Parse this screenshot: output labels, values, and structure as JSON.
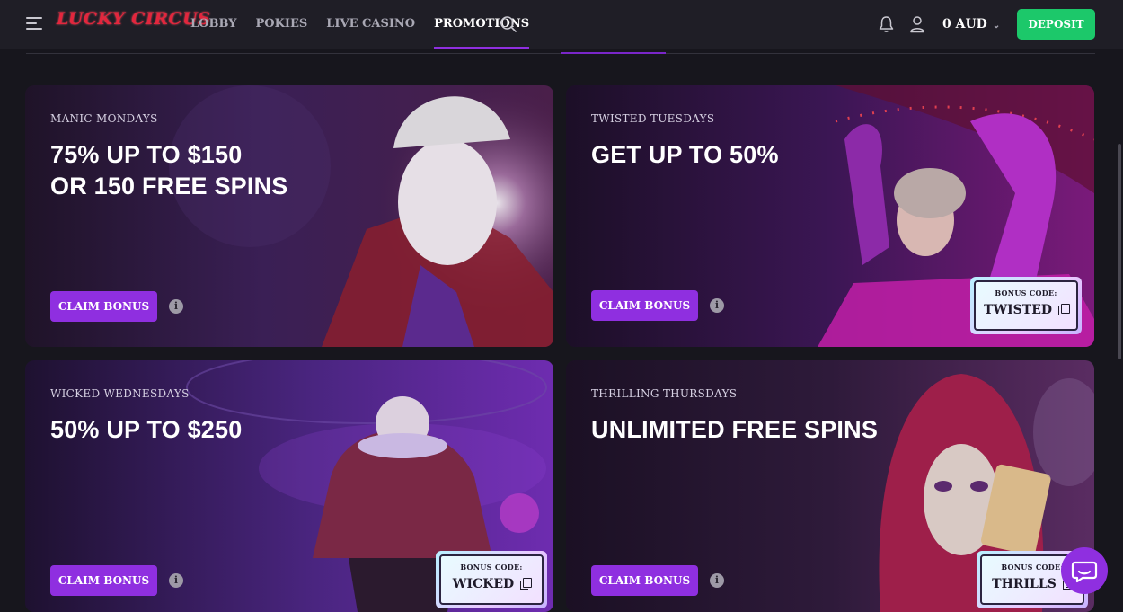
{
  "header": {
    "logo": "LUCKY CIRCUS",
    "nav": [
      "LOBBY",
      "POKIES",
      "LIVE CASINO",
      "PROMOTIONS"
    ],
    "active_nav": "PROMOTIONS",
    "balance": "0 AUD",
    "deposit_label": "DEPOSIT"
  },
  "promotions": [
    {
      "label": "MANIC MONDAYS",
      "title_line1": "75% UP TO $150",
      "title_line2": "OR 150 FREE SPINS",
      "claim_label": "CLAIM BONUS",
      "info": "i",
      "code_label": "",
      "code": ""
    },
    {
      "label": "TWISTED TUESDAYS",
      "title_line1": "GET UP TO 50%",
      "title_line2": "",
      "claim_label": "CLAIM BONUS",
      "info": "i",
      "code_label": "BONUS CODE:",
      "code": "TWISTED"
    },
    {
      "label": "WICKED WEDNESDAYS",
      "title_line1": "50% UP TO $250",
      "title_line2": "",
      "claim_label": "CLAIM BONUS",
      "info": "i",
      "code_label": "BONUS CODE:",
      "code": "WICKED"
    },
    {
      "label": "THRILLING THURSDAYS",
      "title_line1": "UNLIMITED FREE SPINS",
      "title_line2": "",
      "claim_label": "CLAIM BONUS",
      "info": "i",
      "code_label": "BONUS CODE:",
      "code": "THRILLS"
    }
  ],
  "colors": {
    "accent": "#8f2fe0",
    "deposit": "#1cc86a",
    "background": "#17161d",
    "header": "#1f1e26"
  },
  "icons": [
    "menu-icon",
    "search-icon",
    "bell-icon",
    "user-icon",
    "chevron-down-icon",
    "info-icon",
    "copy-icon",
    "chat-icon"
  ]
}
